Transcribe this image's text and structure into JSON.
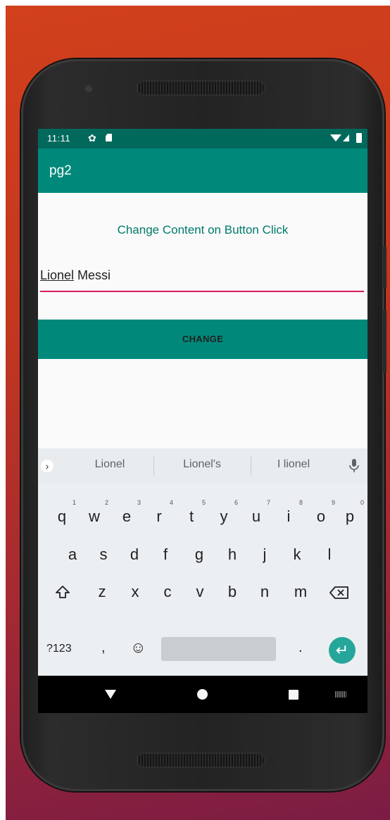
{
  "status_bar": {
    "time": "11:11",
    "icons": [
      "settings-icon",
      "sd-card-icon",
      "wifi-icon",
      "signal-icon",
      "battery-icon"
    ]
  },
  "app_bar": {
    "title": "pg2"
  },
  "content": {
    "heading": "Change Content on Button Click",
    "edit_text": {
      "word1": "Lionel",
      "word2": " Messi"
    },
    "button_label": "CHANGE"
  },
  "keyboard": {
    "suggestions": [
      "Lionel",
      "Lionel's",
      "I lionel"
    ],
    "row1": [
      {
        "k": "q",
        "n": "1"
      },
      {
        "k": "w",
        "n": "2"
      },
      {
        "k": "e",
        "n": "3"
      },
      {
        "k": "r",
        "n": "4"
      },
      {
        "k": "t",
        "n": "5"
      },
      {
        "k": "y",
        "n": "6"
      },
      {
        "k": "u",
        "n": "7"
      },
      {
        "k": "i",
        "n": "8"
      },
      {
        "k": "o",
        "n": "9"
      },
      {
        "k": "p",
        "n": "0"
      }
    ],
    "row2": [
      "a",
      "s",
      "d",
      "f",
      "g",
      "h",
      "j",
      "k",
      "l"
    ],
    "row3": [
      "z",
      "x",
      "c",
      "v",
      "b",
      "n",
      "m"
    ],
    "symbols_label": "?123",
    "comma": ",",
    "period": ".",
    "emoji": "☺"
  },
  "colors": {
    "status_bar": "#00695c",
    "primary": "#00897b",
    "heading_text": "#00796b",
    "accent": "#d81b60",
    "enter_key": "#26a69a"
  }
}
